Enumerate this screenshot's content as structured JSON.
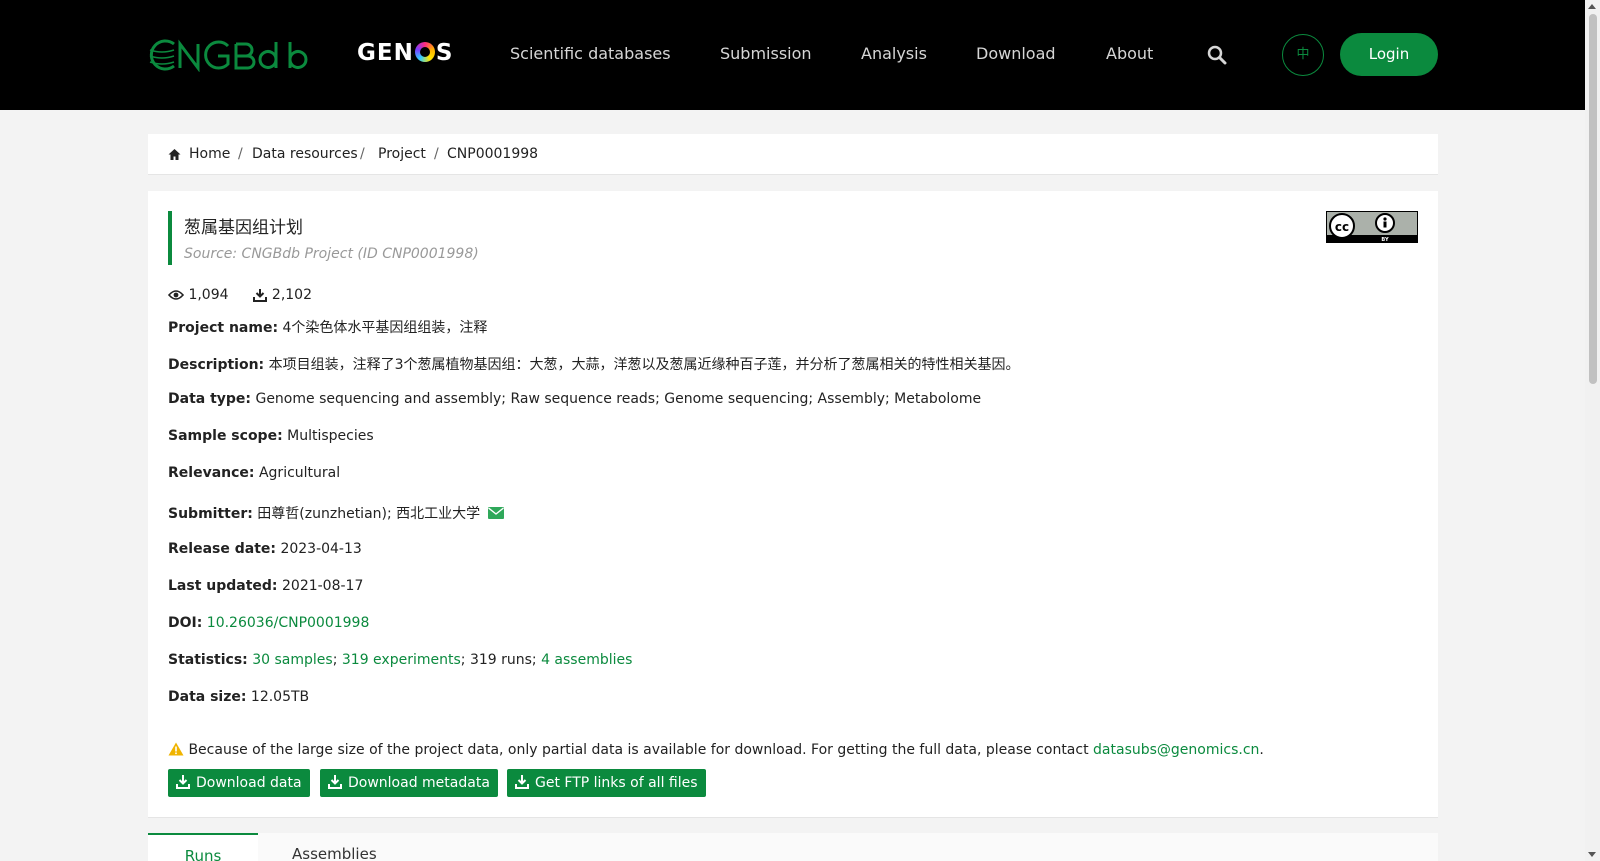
{
  "header": {
    "logo_text": "CNGBdb",
    "genos_logo": "GENOS",
    "nav": [
      "Scientific databases",
      "Submission",
      "Analysis",
      "Download",
      "About"
    ],
    "lang_label": "中",
    "login_label": "Login"
  },
  "breadcrumb": [
    "Home",
    "Data resources",
    "Project",
    "CNP0001998"
  ],
  "project": {
    "title": "葱属基因组计划",
    "source": "Source: CNGBdb Project (ID CNP0001998)",
    "license": "CC BY",
    "views": "1,094",
    "downloads": "2,102",
    "fields": {
      "project_name": {
        "label": "Project name:",
        "value": "4个染色体水平基因组组装，注释"
      },
      "description": {
        "label": "Description:",
        "value": "本项目组装，注释了3个葱属植物基因组：大葱，大蒜，洋葱以及葱属近缘种百子莲，并分析了葱属相关的特性相关基因。"
      },
      "data_type": {
        "label": "Data type:",
        "value": "Genome sequencing and assembly; Raw sequence reads; Genome sequencing; Assembly; Metabolome"
      },
      "sample_scope": {
        "label": "Sample scope:",
        "value": "Multispecies"
      },
      "relevance": {
        "label": "Relevance:",
        "value": "Agricultural"
      },
      "submitter": {
        "label": "Submitter:",
        "value": "田尊哲(zunzhetian); 西北工业大学"
      },
      "release_date": {
        "label": "Release date:",
        "value": "2023-04-13"
      },
      "last_updated": {
        "label": "Last updated:",
        "value": "2021-08-17"
      },
      "doi": {
        "label": "DOI:",
        "value": "10.26036/CNP0001998"
      },
      "statistics": {
        "label": "Statistics:",
        "samples": "30 samples",
        "experiments": "319 experiments",
        "runs": "319 runs",
        "assemblies": "4 assemblies"
      },
      "data_size": {
        "label": "Data size:",
        "value": "12.05TB"
      }
    },
    "notice": {
      "text": "Because of the large size of the project data, only partial data is available for download. For getting the full data, please contact",
      "email": "datasubs@genomics.cn"
    },
    "buttons": [
      "Download data",
      "Download metadata",
      "Get FTP links of all files"
    ]
  },
  "tabs": [
    "Runs",
    "Assemblies"
  ],
  "colors": {
    "accent": "#0b8a3e",
    "header_bg": "#000000",
    "warning": "#f0b400"
  }
}
